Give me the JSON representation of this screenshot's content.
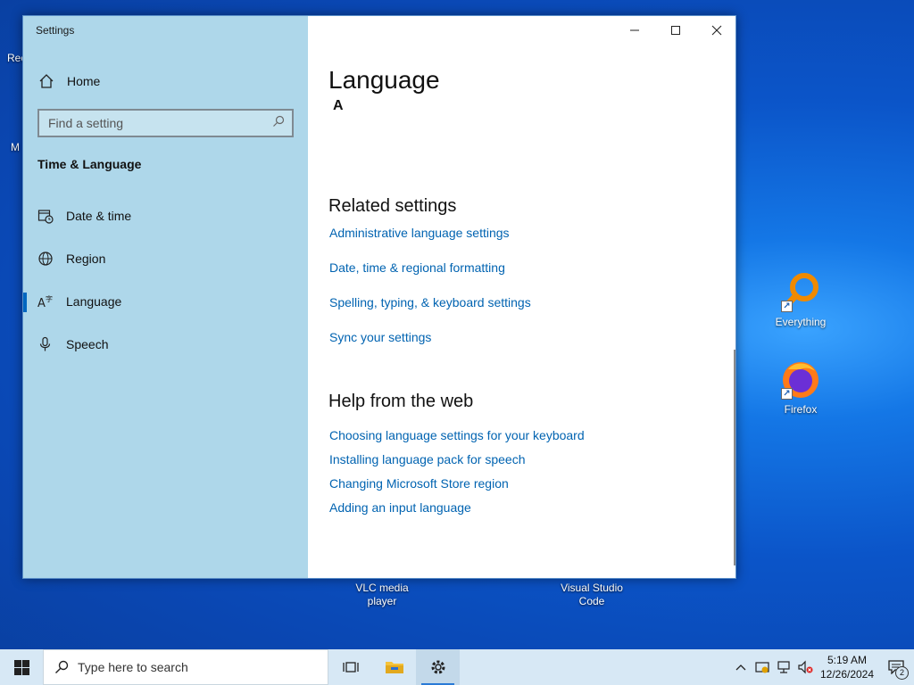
{
  "desktop": {
    "icons": [
      {
        "label": "Everything"
      },
      {
        "label": "Firefox"
      },
      {
        "label": "VLC media player"
      },
      {
        "label": "Visual Studio Code"
      }
    ],
    "partial_left_labels": [
      "Rec",
      "M"
    ]
  },
  "window": {
    "app_title": "Settings",
    "sidebar": {
      "home_label": "Home",
      "search_placeholder": "Find a setting",
      "section_title": "Time & Language",
      "items": [
        {
          "label": "Date & time",
          "icon": "calendar-clock-icon"
        },
        {
          "label": "Region",
          "icon": "globe-icon"
        },
        {
          "label": "Language",
          "icon": "language-icon",
          "selected": true
        },
        {
          "label": "Speech",
          "icon": "microphone-icon"
        }
      ]
    },
    "content": {
      "page_title": "Language",
      "stray_glyph": "A",
      "related_title": "Related settings",
      "related_links": [
        "Administrative language settings",
        "Date, time & regional formatting",
        "Spelling, typing, & keyboard settings",
        "Sync your settings"
      ],
      "help_title": "Help from the web",
      "help_links": [
        "Choosing language settings for your keyboard",
        "Installing language pack for speech",
        "Changing Microsoft Store region",
        "Adding an input language"
      ]
    }
  },
  "taskbar": {
    "search_placeholder": "Type here to search",
    "clock_time": "5:19 AM",
    "clock_date": "12/26/2024",
    "notification_count": "2"
  },
  "colors": {
    "sidebar_bg": "#aed7ea",
    "link": "#0063b1",
    "accent": "#0067c0",
    "taskbar_bg": "#d7e8f5"
  }
}
